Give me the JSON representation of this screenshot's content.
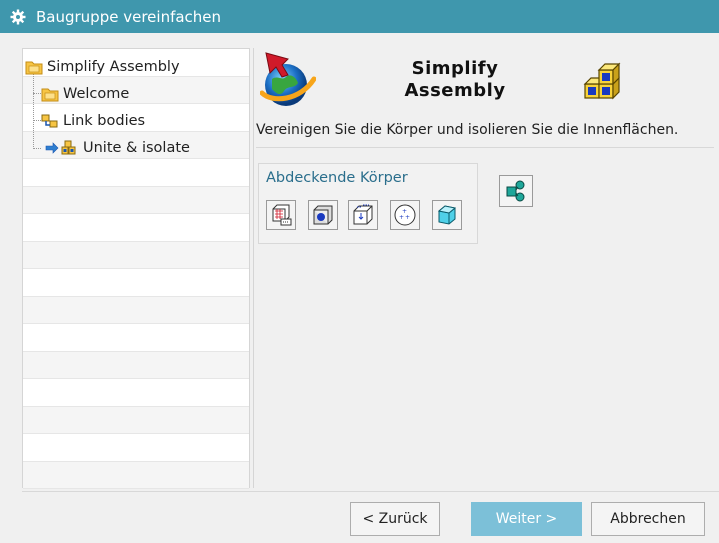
{
  "window": {
    "title": "Baugruppe vereinfachen"
  },
  "tree": {
    "root": "Simplify Assembly",
    "children": [
      "Welcome",
      "Link bodies",
      "Unite & isolate"
    ]
  },
  "header": {
    "title_line1": "Simplify",
    "title_line2": "Assembly"
  },
  "instruction": "Vereinigen Sie die Körper und isolieren Sie die Innenflächen.",
  "group": {
    "label": "Abdeckende Körper",
    "buttons": [
      "select-faces-icon",
      "box-body-icon",
      "bounding-box-icon",
      "point-cloud-icon",
      "cube-icon"
    ]
  },
  "footer": {
    "back": "< Zurück",
    "next": "Weiter >",
    "cancel": "Abbrechen"
  },
  "colors": {
    "titlebar": "#3f97ad",
    "primary": "#7cc0d8",
    "link": "#2a6e8c"
  }
}
